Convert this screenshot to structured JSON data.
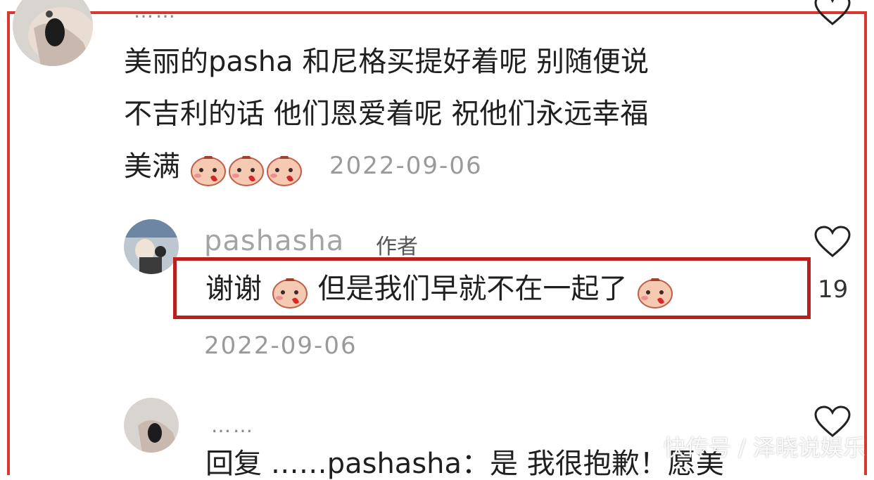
{
  "top_comment": {
    "author_dots": "……",
    "lines": [
      "美丽的pasha 和尼格买提好着呢 别随便说",
      "不吉利的话 他们恩爱着呢  祝他们永远幸福",
      "美满"
    ],
    "emojis": [
      "crying-face-icon",
      "crying-face-icon",
      "crying-face-icon"
    ],
    "date": "2022-09-06"
  },
  "reply": {
    "username": "pashasha",
    "author_tag": "作者",
    "text_part1": "谢谢",
    "text_part2": "但是我们早就不在一起了",
    "likes": "19",
    "date": "2022-09-06"
  },
  "next_comment": {
    "author_dots": "……",
    "partial_text": "回复 ……pashasha：是 我很抱歉！愿美"
  },
  "watermark": "快传号 / 泽晓说娱乐",
  "colors": {
    "highlight_border": "#d9382e",
    "date_gray": "#9a9a9a"
  }
}
